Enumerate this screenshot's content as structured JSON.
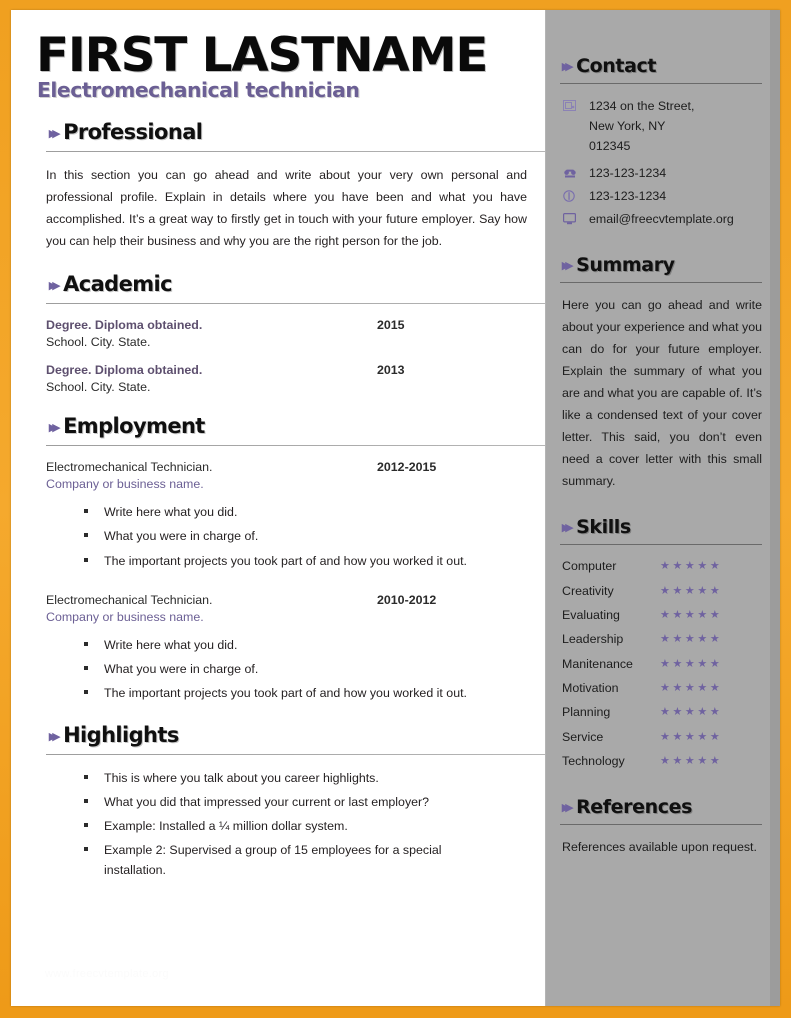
{
  "theme": {
    "border_color": "#F5A623",
    "sidebar_bg": "#A9A9A9",
    "accent_purple": "#6B5F94",
    "chevron_purple": "#6F62A0",
    "heading_black": "#101010",
    "body_text": "#231f20"
  },
  "header": {
    "name": "FIRST LASTNAME",
    "job_title": "Electromechanical technician"
  },
  "chevron_glyph": "▸▸",
  "main": {
    "professional": {
      "heading": "Professional",
      "paragraph": "In this section you can go ahead and write about your very own personal and professional profile. Explain in details where you have been and what you have accomplished. It’s a great way to firstly get in touch with your future employer. Say how you can help their business and why you are the right person for the job."
    },
    "academic": {
      "heading": "Academic",
      "entries": [
        {
          "title": "Degree. Diploma obtained.",
          "date": "2015",
          "subtitle": "School. City. State."
        },
        {
          "title": "Degree. Diploma obtained.",
          "date": "2013",
          "subtitle": "School. City. State."
        }
      ]
    },
    "employment": {
      "heading": "Employment",
      "entries": [
        {
          "title": "Electromechanical Technician.",
          "date": "2012-2015",
          "company": "Company or business name.",
          "bullets": [
            "Write here what you did.",
            "What you were in charge of.",
            "The important projects you took part of and how you worked it out."
          ]
        },
        {
          "title": "Electromechanical Technician.",
          "date": "2010-2012",
          "company": "Company or business name.",
          "bullets": [
            "Write here what you did.",
            "What you were in charge of.",
            "The important projects you took part of and how you worked it out."
          ]
        }
      ]
    },
    "highlights": {
      "heading": "Highlights",
      "bullets": [
        "This is where you talk about you career highlights.",
        "What you did that impressed your current or last employer?",
        "Example: Installed a ¼ million dollar system.",
        "Example 2: Supervised a group of 15 employees for a special installation."
      ]
    },
    "watermark": "www.freecvtemplate.org"
  },
  "sidebar": {
    "contact": {
      "heading": "Contact",
      "rows": [
        {
          "icon": "address-icon",
          "lines": [
            "1234 on the Street,",
            "New York, NY",
            "012345"
          ]
        },
        {
          "icon": "telephone-icon",
          "lines": [
            "123-123-1234"
          ]
        },
        {
          "icon": "mobile-phone-icon",
          "lines": [
            "123-123-1234"
          ]
        },
        {
          "icon": "email-monitor-icon",
          "lines": [
            "email@freecvtemplate.org"
          ]
        }
      ]
    },
    "summary": {
      "heading": "Summary",
      "paragraph": "Here you can go ahead and write about your experience and what you can do for your future employer. Explain the summary of what you are and what you are capable of. It’s like a condensed text of your cover letter. This said, you don’t even need a cover letter with this small summary."
    },
    "skills": {
      "heading": "Skills",
      "max_stars": 5,
      "items": [
        {
          "name": "Computer",
          "rating": 5
        },
        {
          "name": "Creativity",
          "rating": 5
        },
        {
          "name": "Evaluating",
          "rating": 5
        },
        {
          "name": "Leadership",
          "rating": 5
        },
        {
          "name": "Manitenance",
          "rating": 5
        },
        {
          "name": "Motivation",
          "rating": 5
        },
        {
          "name": "Planning",
          "rating": 5
        },
        {
          "name": "Service",
          "rating": 5
        },
        {
          "name": "Technology",
          "rating": 5
        }
      ]
    },
    "references": {
      "heading": "References",
      "text": "References available upon request."
    }
  }
}
